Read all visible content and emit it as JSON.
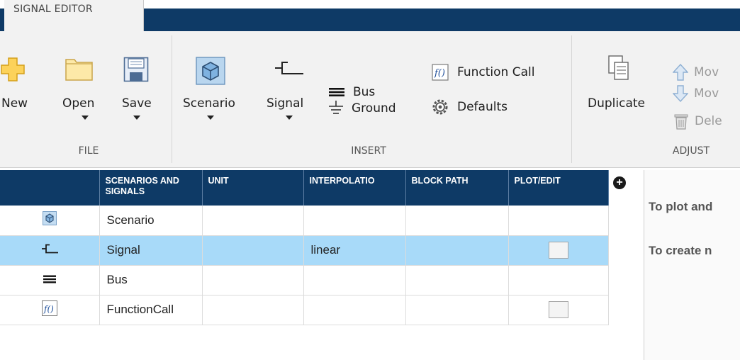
{
  "tab": {
    "label": "SIGNAL EDITOR"
  },
  "ribbon": {
    "file": {
      "group_label": "FILE",
      "new_label": "New",
      "open_label": "Open",
      "save_label": "Save"
    },
    "insert": {
      "group_label": "INSERT",
      "scenario_label": "Scenario",
      "signal_label": "Signal",
      "bus_label": "Bus",
      "ground_label": "Ground",
      "function_call_label": "Function Call",
      "defaults_label": "Defaults"
    },
    "adjust": {
      "group_label": "ADJUST",
      "duplicate_label": "Duplicate",
      "move_up_label": "Mov",
      "move_down_label": "Mov",
      "delete_label": "Dele"
    }
  },
  "grid": {
    "headers": {
      "scenarios_signals": "SCENARIOS AND SIGNALS",
      "unit": "UNIT",
      "interpolation": "INTERPOLATIO",
      "block_path": "BLOCK PATH",
      "plot_edit": "PLOT/EDIT"
    },
    "add_column_symbol": "+",
    "rows": [
      {
        "icon": "scenario-icon",
        "name": "Scenario",
        "unit": "",
        "interpolation": "",
        "block_path": ""
      },
      {
        "icon": "signal-icon",
        "name": "Signal",
        "unit": "",
        "interpolation": "linear",
        "block_path": ""
      },
      {
        "icon": "bus-icon",
        "name": "Bus",
        "unit": "",
        "interpolation": "",
        "block_path": ""
      },
      {
        "icon": "function-call-icon",
        "name": "FunctionCall",
        "unit": "",
        "interpolation": "",
        "block_path": ""
      }
    ]
  },
  "right_panel": {
    "line1": "To plot and",
    "line2": "To create n"
  },
  "colors": {
    "header_navy": "#0e3a66",
    "selected_row": "#a8daf9",
    "ribbon_bg": "#f2f2f2"
  }
}
